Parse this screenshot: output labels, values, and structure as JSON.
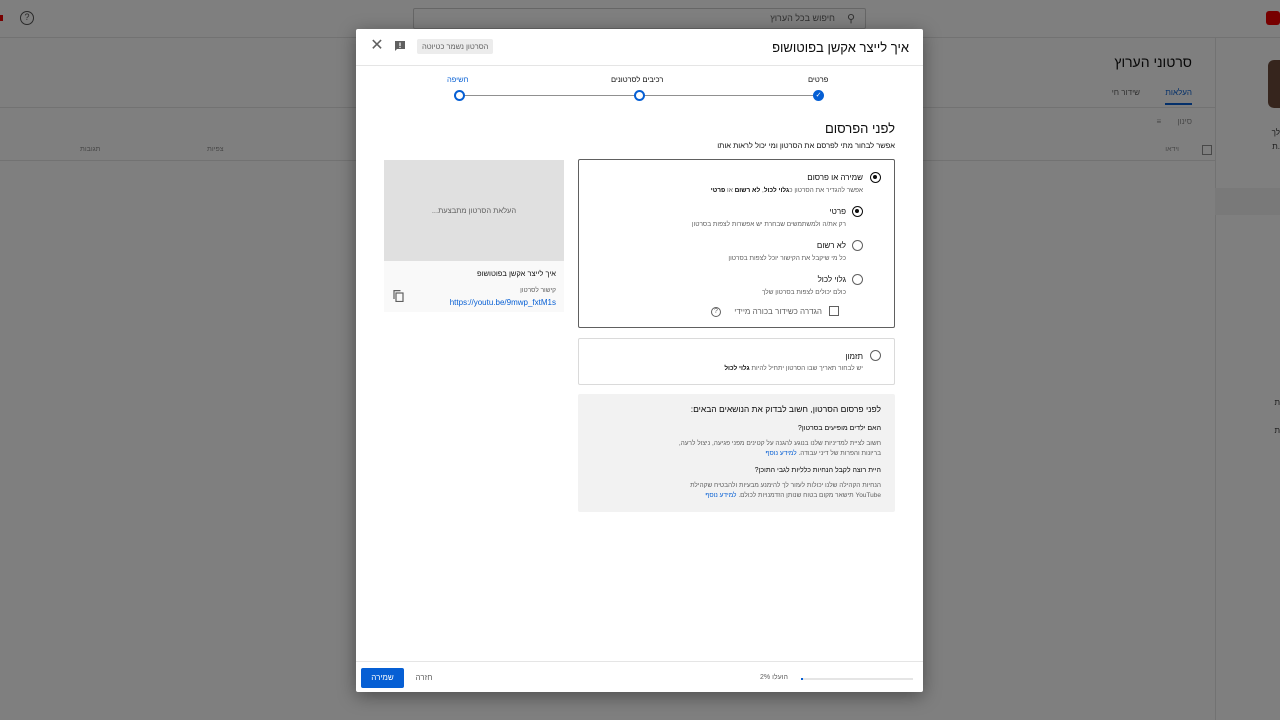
{
  "background": {
    "search_placeholder": "חיפוש בכל הערוץ",
    "page_title": "סרטוני הערוץ",
    "tabs": [
      {
        "label": "העלאות",
        "active": true
      },
      {
        "label": "שידור חי",
        "active": false
      }
    ],
    "filter_placeholder": "סינון",
    "columns": [
      "וידאו",
      "צפיות",
      "תגובות"
    ],
    "side_letters": [
      "לך",
      "ת.",
      "ת",
      "ת"
    ]
  },
  "dialog": {
    "title": "איך לייצר אקשן בפוטושופ",
    "saved_badge": "הסרטון נשמר כטיוטה",
    "steps": [
      {
        "label": "פרטים",
        "state": "done"
      },
      {
        "label": "רכיבים לסרטונים",
        "state": "todo"
      },
      {
        "label": "חשיפה",
        "state": "current"
      }
    ],
    "section_title": "לפני הפרסום",
    "section_subtitle": "אפשר לבחור מתי לפרסם את הסרטון ומי יכול לראות אותו",
    "save_or_publish": {
      "title": "שמירה או פרסום",
      "desc_prefix": "אפשר להגדיר את הסרטון כ",
      "desc_public": "גלוי לכול",
      "desc_sep1": ", ",
      "desc_unlisted": "לא רשום",
      "desc_or": " או ",
      "desc_private": "פרטי"
    },
    "options": [
      {
        "title": "פרטי",
        "desc": "רק ",
        "desc_rest": "ולמשתמשים שבחרת יש אפשרות לצפות בסרטון",
        "desc_you": "את/ה",
        "selected": true
      },
      {
        "title": "לא רשום",
        "desc": "כל מי שיקבל את הקישור יוכל לצפות בסרטון",
        "selected": false
      },
      {
        "title": "גלוי לכול",
        "desc": "כולם יכולים לצפות בסרטון שלך",
        "selected": false
      }
    ],
    "premiere_label": "הגדרה כשידור בכורה מיידי",
    "schedule": {
      "title": "תזמון",
      "desc_prefix": "יש לבחור תאריך שבו הסרטון יתחיל להיות ",
      "desc_bold": "גלוי לכול"
    },
    "checklist": {
      "title": "לפני פרסום הסרטון, חשוב לבדוק את הנושאים הבאים:",
      "q1": "האם ילדים מופיעים בסרטון?",
      "t1_line1": "חשוב לציית למדיניות שלנו בנוגע להגנה על קטינים מפני פגיעה, ניצול לרעה,",
      "t1_line2": "בריונות והפרות של דיני עבודה.",
      "t1_link": "למידע נוסף",
      "q2": "היית רוצה לקבל הנחיות כלליות לגבי התוכן?",
      "t2_line1": "הנחיות הקהילה שלנו יכולות לעזור לך להימנע מבעיות ולהבטיח שקהילת",
      "t2_line2": "YouTube תישאר מקום בטוח שנותן הזדמנויות לכולם.",
      "t2_link": "למידע נוסף"
    },
    "preview": {
      "status": "העלאת הסרטון מתבצעת...",
      "video_title": "איך לייצר אקשן בפוטושופ",
      "link_label": "קישור לסרטון",
      "link": "https://youtu.be/9mwp_fxtM1s"
    },
    "footer": {
      "save_label": "שמירה",
      "back_label": "חזרה",
      "progress_text": "הועלו 2%",
      "progress": 0.02
    }
  },
  "colors": {
    "accent": "#065fd4",
    "scrim": "rgba(0,0,0,0.5)"
  }
}
